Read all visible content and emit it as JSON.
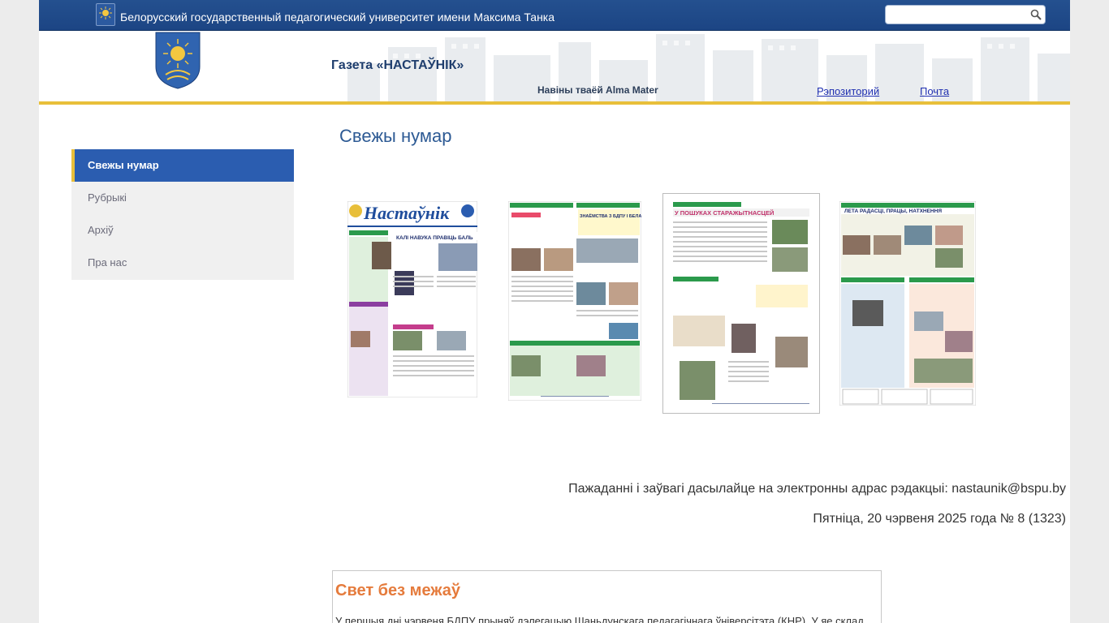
{
  "topbar": {
    "university": "Белорусский государственный педагогический университет имени Максима Танка",
    "search_placeholder": ""
  },
  "header": {
    "paper_title": "Газета «НАСТАЎНІК»",
    "tagline": "Навіны тваёй Alma Mater",
    "links": [
      {
        "label": "Рэпозиторий"
      },
      {
        "label": "Почта"
      }
    ]
  },
  "sidebar": {
    "items": [
      {
        "label": "Свежы нумар",
        "active": true
      },
      {
        "label": "Рубрыкі",
        "active": false
      },
      {
        "label": "Архіў",
        "active": false
      },
      {
        "label": "Пра нас",
        "active": false
      }
    ]
  },
  "main": {
    "title": "Свежы нумар",
    "pages": [
      {
        "name": "page-1",
        "header": "Настаўнік",
        "headline": "КАЛІ НАВУКА ПРАВІЦЬ БАЛЬ"
      },
      {
        "name": "page-2",
        "headline": "ЗНАЁМСТВА З БДПУ І БЕЛАРУССЮ У ФАРМАЦЕ «ІНТЭНСІЎ»"
      },
      {
        "name": "page-3",
        "headline": "У ПОШУКАХ СТАРАЖЫТНАСЦЕЙ"
      },
      {
        "name": "page-4",
        "headline": "ЛЕТА РАДАСЦІ, ПРАЦЫ, НАТХНЕННЯ"
      }
    ],
    "contact_text": "Пажаданні і заўвагі дасылайце на электронны адрас рэдакцыі: nastaunik@bspu.by",
    "issue_info": "Пятніца, 20 чэрвеня 2025 года № 8 (1323)"
  },
  "article": {
    "title": "Свет без межаў",
    "excerpt": "У першыя дні чэрвеня БДПУ прыняў дэлегацыю Шаньдунскага педагагічнага ўніверсітэта (КНР). У яе склад"
  },
  "colors": {
    "topbar": "#1c4584",
    "accent_gold": "#e8bf3a",
    "nav_active": "#2b5db0",
    "title_blue": "#2d5a94",
    "article_orange": "#e57b3c"
  }
}
